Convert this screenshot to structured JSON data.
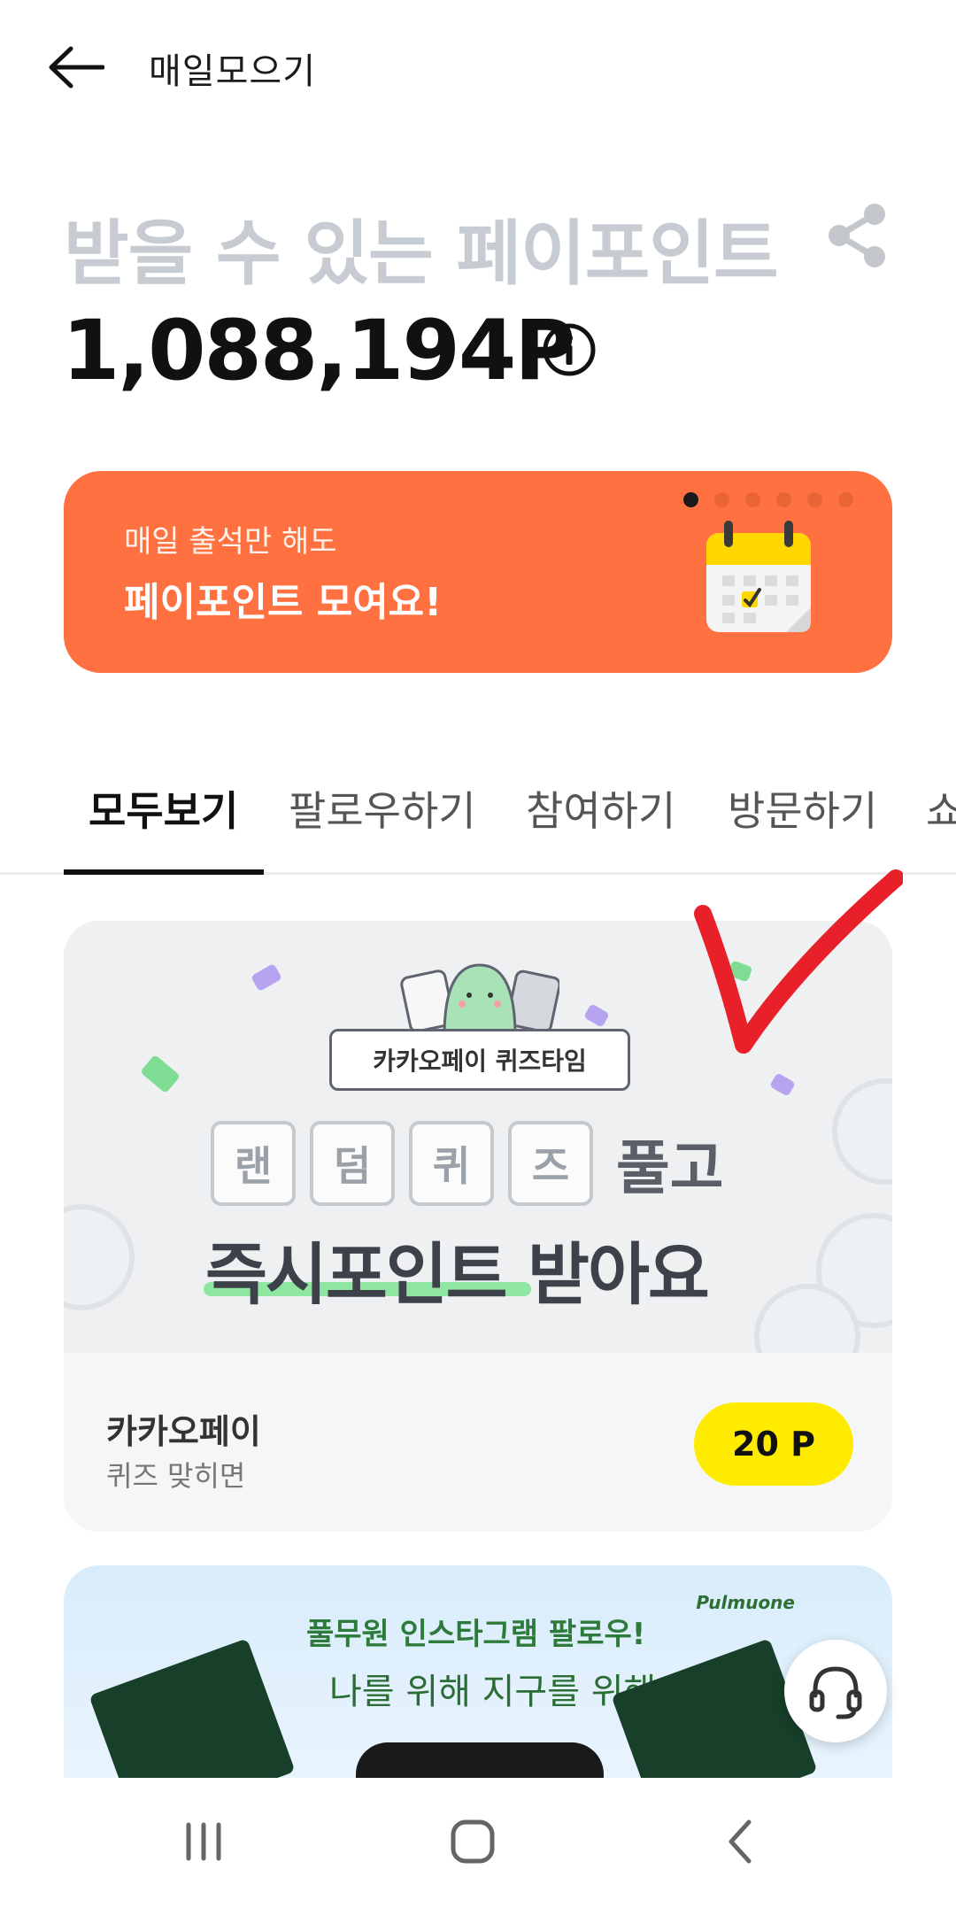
{
  "header": {
    "title": "매일모으기",
    "back_icon": "arrow-left-icon"
  },
  "points": {
    "label": "받을 수 있는 페이포인트",
    "value": "1,088,194P",
    "share_icon": "share-icon",
    "info_icon": "info-icon"
  },
  "banner": {
    "subtitle": "매일 출석만 해도",
    "title": "페이포인트 모여요!",
    "page_count": 6,
    "active_page": 1,
    "icon": "calendar-icon",
    "color": "#ff7140"
  },
  "tabs": [
    {
      "label": "모두보기",
      "active": true
    },
    {
      "label": "팔로우하기",
      "active": false
    },
    {
      "label": "참여하기",
      "active": false
    },
    {
      "label": "방문하기",
      "active": false
    },
    {
      "label": "쇼",
      "active": false
    }
  ],
  "quiz_card": {
    "art": {
      "ribbon": "카카오페이 퀴즈타임",
      "boxes": [
        "랜",
        "덤",
        "퀴",
        "즈"
      ],
      "suffix": "풀고",
      "line2": "즉시포인트 받아요"
    },
    "company": "카카오페이",
    "description": "퀴즈 맞히면",
    "points": "20 P",
    "badge_color": "#ffeb00"
  },
  "second_card": {
    "title": "풀무원 인스타그램 팔로우!",
    "handwriting": "나를 위해 지구를 위해",
    "brand": "Pulmuone"
  },
  "support_button": {
    "icon": "headset-icon"
  },
  "navbar": {
    "recent_icon": "recent-apps-icon",
    "home_icon": "home-icon",
    "back_icon": "back-icon"
  },
  "overlay": {
    "icon": "red-checkmark-icon",
    "color": "#e8202a"
  }
}
